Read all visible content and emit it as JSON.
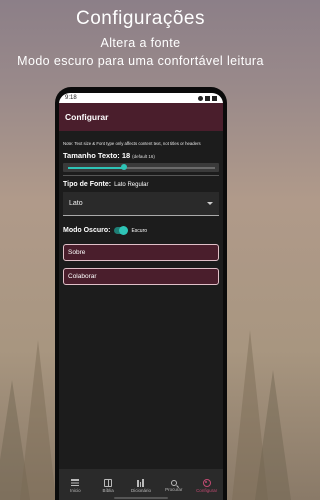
{
  "promo": {
    "title": "Configurações",
    "subtitle1": "Altera a fonte",
    "subtitle2": "Modo escuro para uma confortável leitura"
  },
  "statusbar": {
    "time": "9:18"
  },
  "appbar": {
    "title": "Configurar"
  },
  "settings": {
    "note": "Note: Text size & Font type only affects content text, not titles or headers",
    "size_label": "Tamanho Texto:",
    "size_value": "18",
    "size_default": "(default 16)",
    "slider_fraction": 0.38,
    "font_label": "Tipo de Fonte:",
    "font_current": "Lato Regular",
    "font_select_value": "Lato",
    "dark_label": "Modo Oscuro:",
    "dark_state": "Escuro",
    "dark_enabled": true,
    "buttons": [
      "Sobre",
      "Colaborar"
    ]
  },
  "nav": {
    "items": [
      {
        "label": "Inicio",
        "icon": "list-icon"
      },
      {
        "label": "Bíblia",
        "icon": "book-icon"
      },
      {
        "label": "Dicionário",
        "icon": "dictionary-icon"
      },
      {
        "label": "Procurar",
        "icon": "search-icon"
      },
      {
        "label": "Configurar",
        "icon": "gear-icon",
        "active": true
      }
    ]
  },
  "colors": {
    "accent": "#2ec4b6",
    "brand": "#4a1e2c",
    "active_nav": "#c24a72"
  }
}
